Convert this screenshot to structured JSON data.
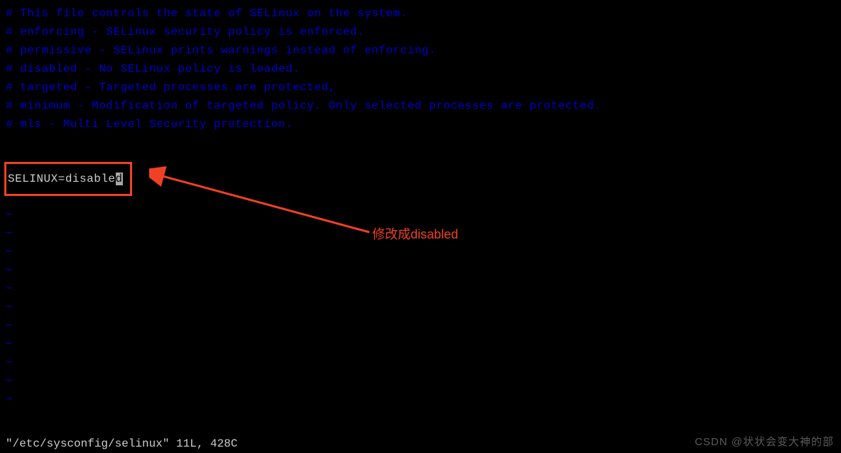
{
  "comments": [
    "# This file controls the state of SELinux on the system.",
    "#     enforcing - SELinux security policy is enforced.",
    "#     permissive - SELinux prints warnings instead of enforcing.",
    "#     disabled - No SELinux policy is loaded.",
    "#     targeted - Targeted processes are protected,",
    "#     minimum - Modification of targeted policy. Only selected processes are protected.",
    "#     mls - Multi Level Security protection."
  ],
  "config": {
    "prefix": "SELINUX=disable",
    "cursor_char": "d"
  },
  "tilde": "~",
  "tilde_count": 11,
  "status": "\"/etc/sysconfig/selinux\" 11L, 428C",
  "annotation": "修改成disabled",
  "watermark": "CSDN @状状会变大神的部"
}
